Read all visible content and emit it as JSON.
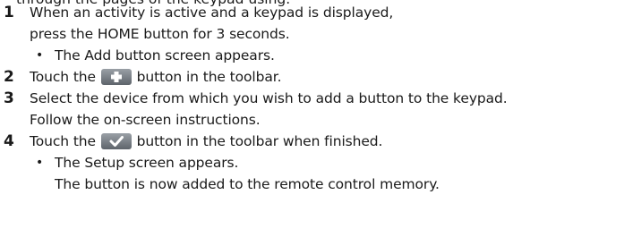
{
  "header_partial": "through the pages of the keypad using.",
  "steps": [
    {
      "number": "1",
      "line1": "When an activity is active and a keypad is displayed,",
      "line2": "press the HOME button for 3 seconds.",
      "bullet": "The Add button screen appears."
    },
    {
      "number": "2",
      "before": "Touch the",
      "button_icon": "plus-icon",
      "after": "button in the toolbar."
    },
    {
      "number": "3",
      "line1": "Select the device from which you wish to add a button to the keypad.",
      "line2": "Follow the on-screen instructions."
    },
    {
      "number": "4",
      "before": "Touch the",
      "button_icon": "checkmark-icon",
      "after": "button in the toolbar when finished.",
      "bullet": "The Setup screen appears.",
      "bullet_line2": "The button is now added to the remote control memory."
    }
  ],
  "bullet_glyph": "•"
}
